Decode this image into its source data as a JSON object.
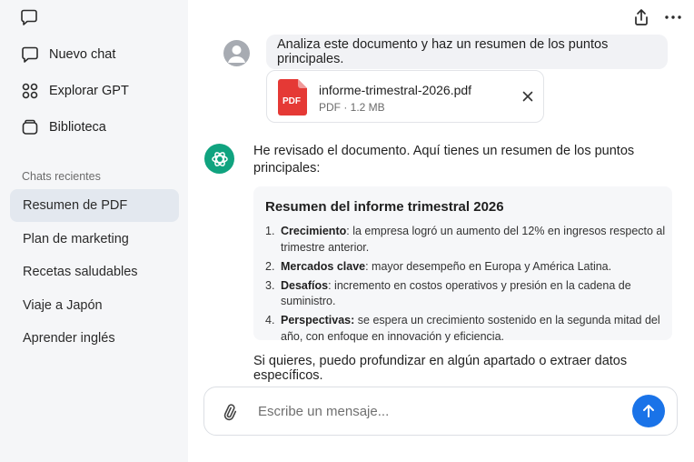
{
  "sidebar": {
    "nav": [
      {
        "label": "Nuevo chat",
        "icon": "new-chat-icon"
      },
      {
        "label": "Explorar GPT",
        "icon": "explore-grid-icon"
      },
      {
        "label": "Biblioteca",
        "icon": "library-icon"
      }
    ],
    "section_label": "Chats recientes",
    "chats": [
      {
        "label": "Resumen de PDF",
        "active": true
      },
      {
        "label": "Plan de marketing",
        "active": false
      },
      {
        "label": "Recetas saludables",
        "active": false
      },
      {
        "label": "Viaje a Japón",
        "active": false
      },
      {
        "label": "Aprender inglés",
        "active": false
      }
    ]
  },
  "conversation": {
    "user_message": "Analiza este documento y haz un resumen de los puntos principales.",
    "attachment": {
      "badge": "PDF",
      "name": "informe-trimestral-2026.pdf",
      "meta": "PDF · 1.2 MB"
    },
    "assistant": {
      "intro": "He revisado el documento. Aquí tienes un resumen de los puntos principales:",
      "summary_title": "Resumen del informe trimestral 2026",
      "points": [
        {
          "num": "1.",
          "term": "Crecimiento",
          "text": ": la empresa logró un aumento del 12% en ingresos respecto al trimestre anterior."
        },
        {
          "num": "2.",
          "term": "Mercados clave",
          "text": ": mayor desempeño en Europa y América Latina."
        },
        {
          "num": "3.",
          "term": "Desafíos",
          "text": ": incremento en costos operativos y presión en la cadena de suministro."
        },
        {
          "num": "4.",
          "term": "Perspectivas:",
          "text": " se espera un crecimiento sostenido en la segunda mitad del año, con enfoque en innovación y eficiencia."
        }
      ],
      "outro": "Si quieres, puedo profundizar en algún apartado o extraer datos específicos."
    }
  },
  "composer": {
    "placeholder": "Escribe un mensaje..."
  },
  "colors": {
    "accent": "#1a73e8",
    "assistant_avatar": "#10a37f",
    "pdf_red": "#e53935",
    "sidebar_bg": "#f5f6f8",
    "active_chat_bg": "#e3e8ef"
  }
}
